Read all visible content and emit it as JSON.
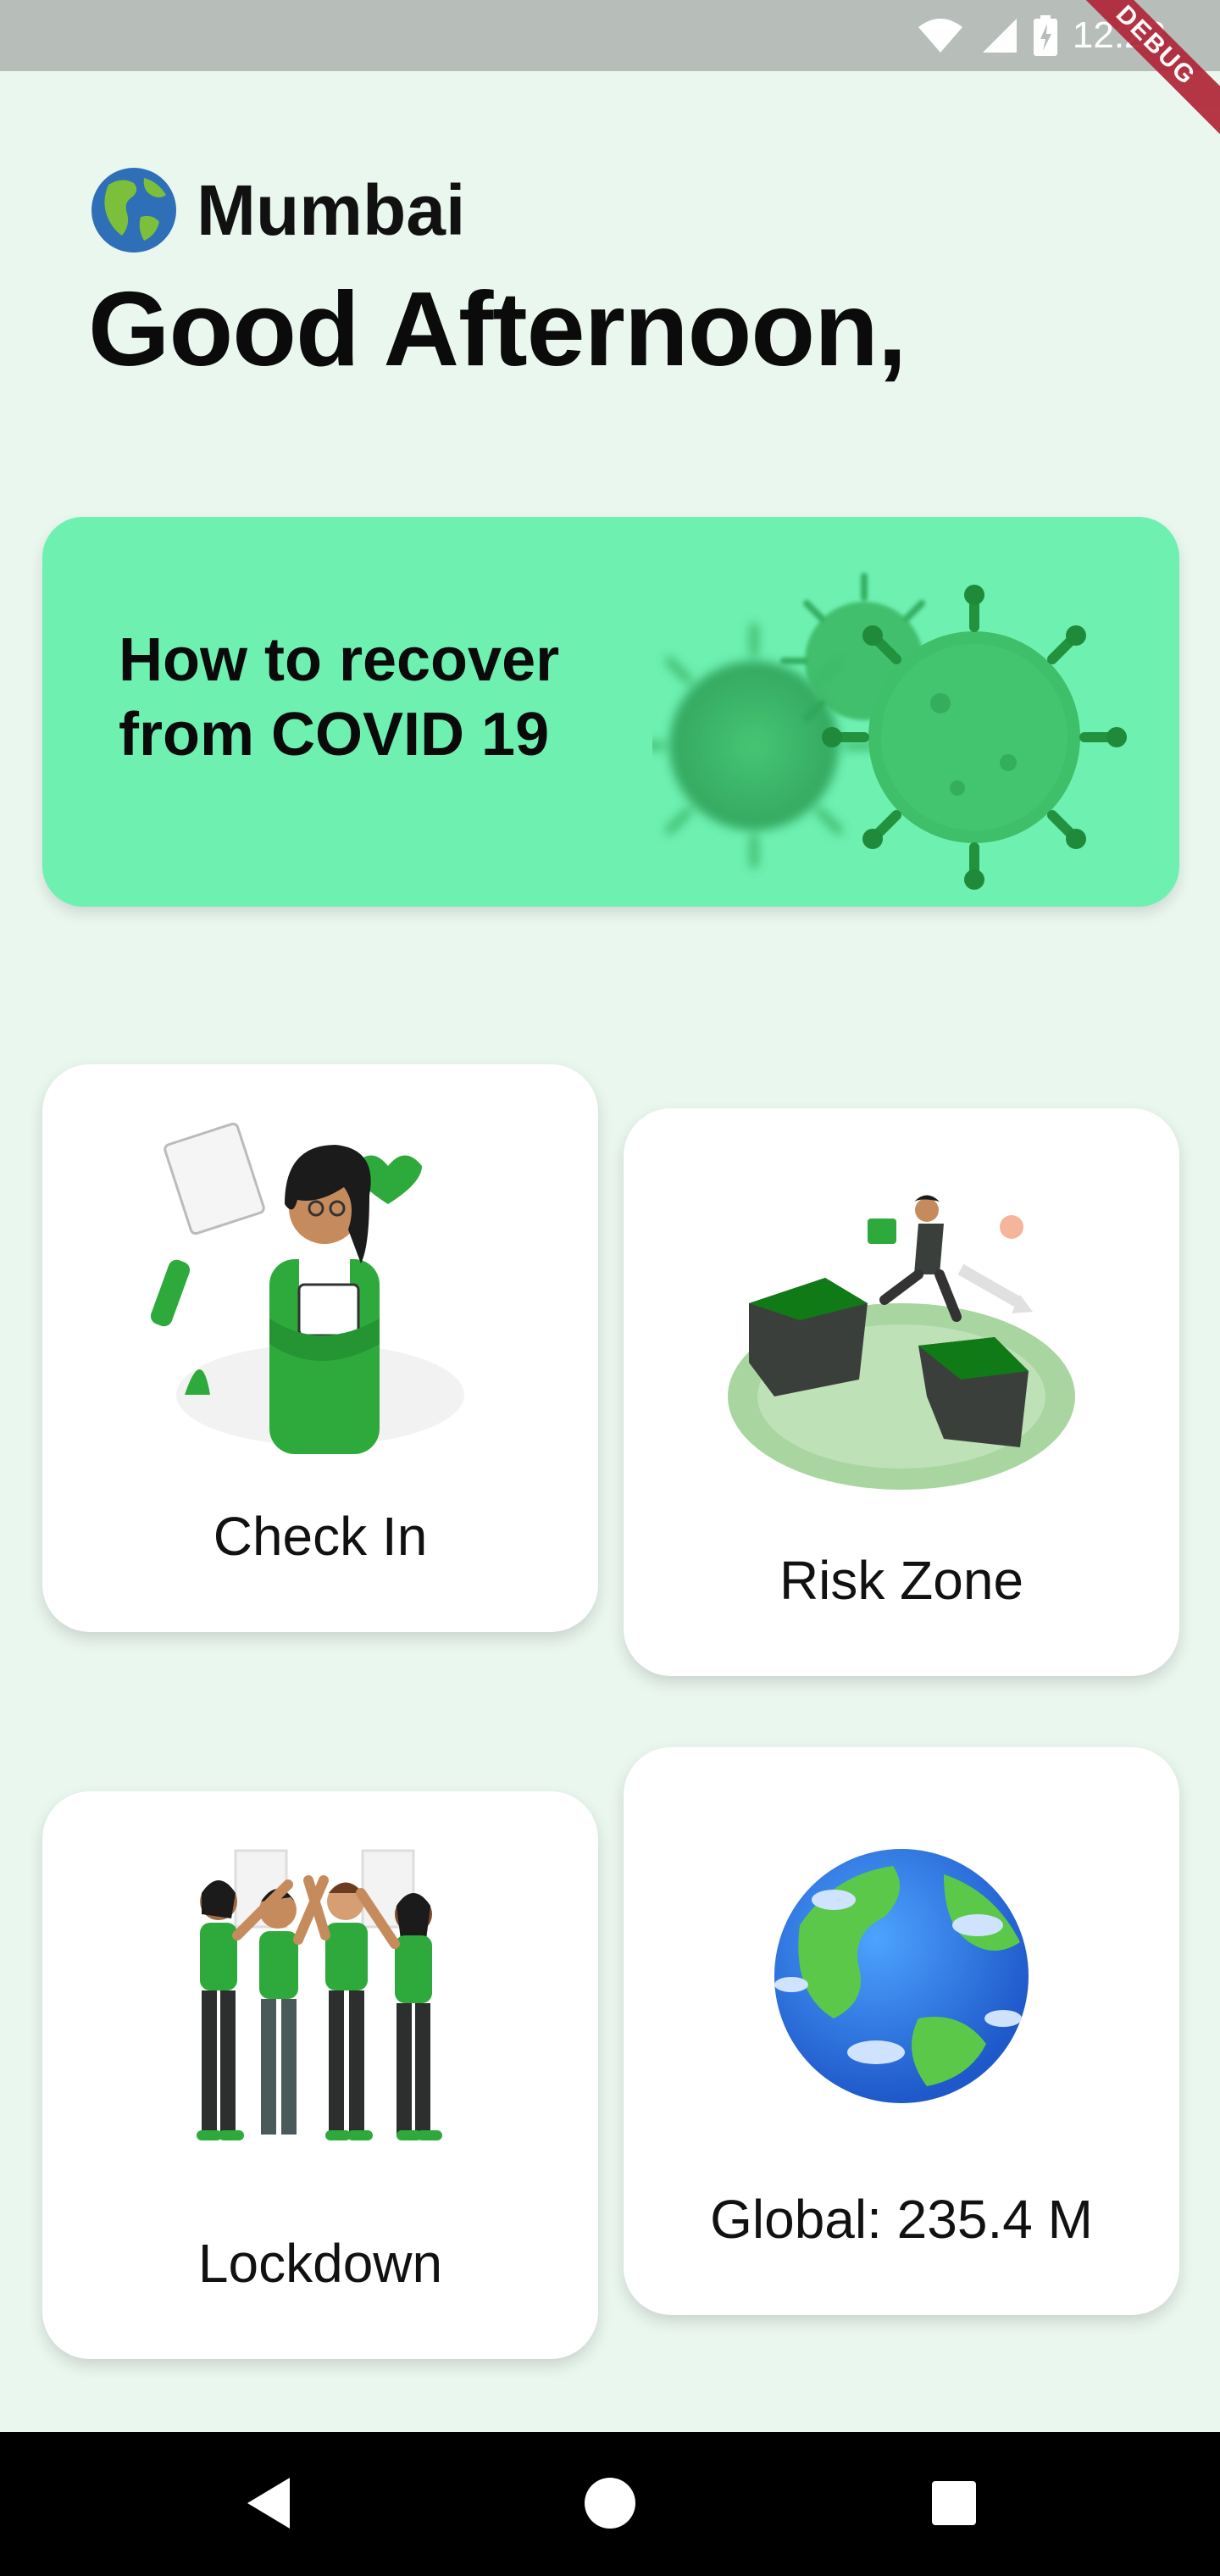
{
  "status_bar": {
    "time": "12:23",
    "debug_label": "DEBUG",
    "icons": [
      "wifi-icon",
      "signal-icon",
      "battery-icon"
    ]
  },
  "header": {
    "location": "Mumbai",
    "location_icon": "globe-icon",
    "greeting": "Good Afternoon,"
  },
  "banner": {
    "title": "How to recover from COVID 19",
    "image": "virus-illustration",
    "color": "#6ef0b1"
  },
  "cards": {
    "check_in": {
      "label": "Check In",
      "image": "doctor-illustration"
    },
    "risk_zone": {
      "label": "Risk Zone",
      "image": "running-person-illustration"
    },
    "lockdown": {
      "label": "Lockdown",
      "image": "group-high-five-illustration"
    },
    "global": {
      "label": "Global: 235.4 M",
      "image": "earth-globe-illustration"
    }
  },
  "nav_bar": {
    "buttons": [
      "back-icon",
      "home-icon",
      "recents-icon"
    ]
  },
  "colors": {
    "background": "#eaf7ef",
    "accent_green": "#2eaa3c",
    "status_bar": "#b7beb9"
  }
}
